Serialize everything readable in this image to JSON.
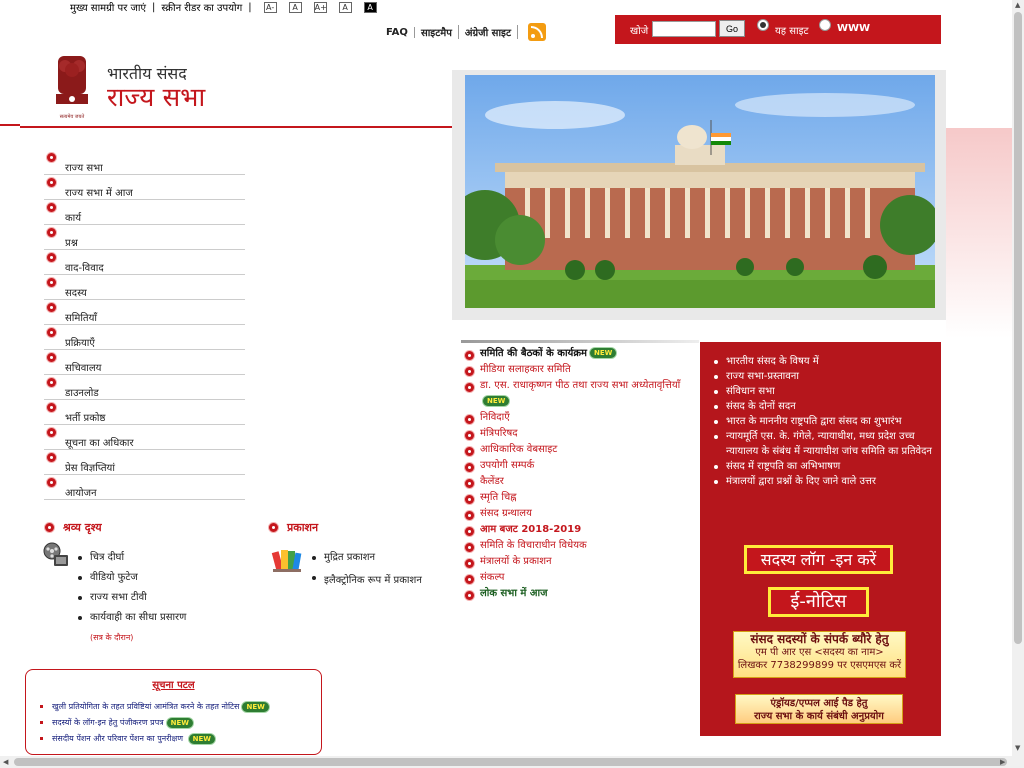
{
  "topbar": {
    "skip": "मुख्य सामग्री पर जाएं",
    "screen_reader": "स्क्रीन रीडर का उपयोग",
    "font_buttons": [
      "A-",
      "A",
      "A+",
      "A",
      "A"
    ]
  },
  "toplinks": {
    "faq": "FAQ",
    "sitemap": "साइटमैप",
    "english": "अंग्रेजी साइट"
  },
  "search": {
    "label": "खोजे",
    "placeholder": "",
    "go": "Go",
    "option1": "यह साइट",
    "option2": "WWW"
  },
  "logo": {
    "line1": "भारतीय संसद",
    "line2": "राज्य सभा",
    "motto": "सत्यमेव जयते"
  },
  "nav": [
    "राज्य सभा",
    "राज्य सभा में आज",
    "कार्य",
    "प्रश्न",
    "वाद-विवाद",
    "सदस्य",
    "समितियाँ",
    "प्रक्रियाएँ",
    "सचिवालय",
    "डाउनलोड",
    "भर्ती प्रकोष्ठ",
    "सूचना का अधिकार",
    "प्रेस विज्ञप्तियां",
    "आयोजन"
  ],
  "audio_visual": {
    "title": "श्रव्य दृश्य",
    "items": [
      "चित्र दीर्घा",
      "वीडियो फुटेज",
      "राज्य सभा टीवी",
      "कार्यवाही का सीधा प्रसारण"
    ],
    "note": "(सत्र के दौरान)"
  },
  "publications": {
    "title": "प्रकाशन",
    "items": [
      "मुद्रित प्रकाशन",
      "इलैक्ट्रोनिक रूप में प्रकाशन"
    ]
  },
  "notice_board": {
    "title": "सूचना पटल",
    "items": [
      "खुली प्रतियोगिता के तहत प्रविष्टियां आमंत्रित करने के तहत नोटिस",
      "सदस्यों के लॉग-इन हेतु पंजीकरण प्रपत्र",
      "संसदीय पेंशन और परिवार पेंशन का पुनरीक्षण"
    ],
    "new_label": "NEW"
  },
  "middle_links": [
    {
      "label": "समिति की बैठकों के कार्यक्रम",
      "new": true
    },
    {
      "label": "मीडिया सलाहकार समिति",
      "new": false
    },
    {
      "label": "डा. एस. राधाकृष्णन पीठ तथा राज्य सभा अध्येतावृत्तियाँ",
      "new": true
    },
    {
      "label": "निविदाएँ",
      "new": false
    },
    {
      "label": "मंत्रिपरिषद",
      "new": false
    },
    {
      "label": "आधिकारिक वेबसाइट",
      "new": false
    },
    {
      "label": "उपयोगी सम्पर्क",
      "new": false
    },
    {
      "label": "कैलेंडर",
      "new": false
    },
    {
      "label": "स्मृति चिह्न",
      "new": false
    },
    {
      "label": "संसद ग्रन्थालय",
      "new": false
    },
    {
      "label": "आम बजट 2018-2019",
      "new": false
    },
    {
      "label": "समिति के विचाराधीन विधेयक",
      "new": false
    },
    {
      "label": "मंत्रालयों के प्रकाशन",
      "new": false
    },
    {
      "label": "संकल्प",
      "new": false
    },
    {
      "label": "लोक सभा में आज",
      "new": false
    }
  ],
  "right_panel": {
    "items": [
      "भारतीय संसद के विषय में",
      "राज्य सभा-प्रस्तावना",
      "संविधान सभा",
      "संसद के दोनों सदन",
      "भारत के माननीय राष्ट्रपति द्वारा संसद का शुभारंभ",
      "न्यायमूर्ति एस. के. गंगेले, न्यायाधीश, मध्य प्रदेश उच्च न्यायालय के संबंध में न्यायाधीश जांच समिति का प्रतिवेदन",
      "संसद में राष्ट्रपति का अभिभाषण",
      "मंत्रालयों द्वारा प्रश्नों के दिए जाने वाले उत्तर"
    ],
    "login": "सदस्य लॉग -इन करें",
    "enotice": "ई-नोटिस",
    "contact_line1": "संसद सदस्यों के संपर्क ब्यौरे हेतु",
    "contact_line2": "एम पी आर एस <सदस्य का नाम>",
    "contact_line3": "लिखकर 7738299899 पर एसएमएस करें",
    "app_line1": "एंड्रॉयड/एप्पल आई पैड हेतु",
    "app_line2": "राज्य सभा के कार्य संबंधी अनुप्रयोग"
  },
  "colors": {
    "brand_red": "#c4161c",
    "panel_red": "#b5161c",
    "badge_green": "#2e7d32",
    "highlight_yellow": "#ffeb3b"
  }
}
